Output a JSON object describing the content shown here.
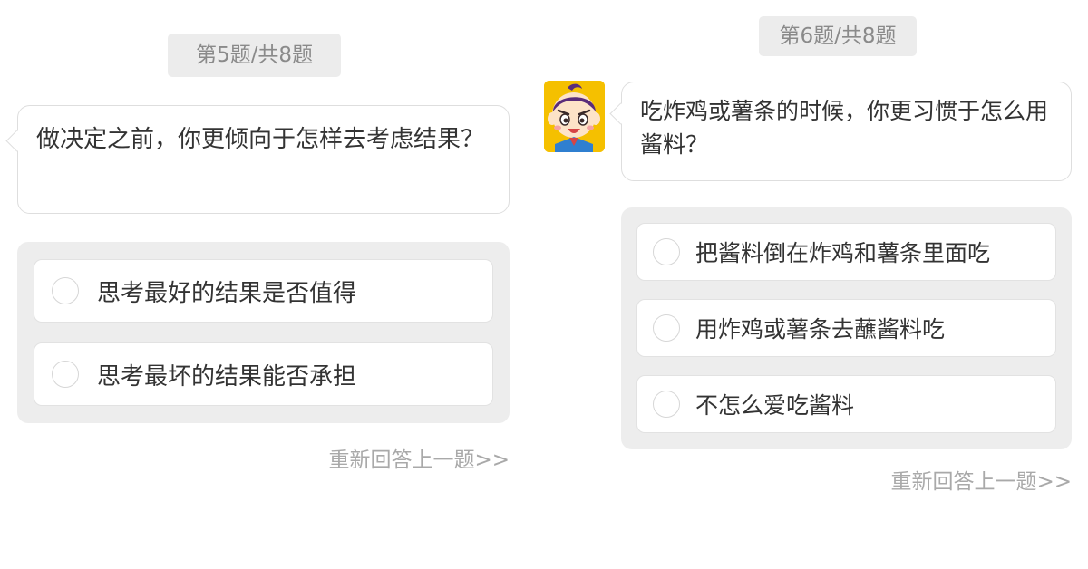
{
  "left_panel": {
    "counter": "第5题/共8题",
    "question": "做决定之前，你更倾向于怎样去考虑结果？",
    "options": [
      {
        "label": "思考最好的结果是否值得"
      },
      {
        "label": "思考最坏的结果能否承担"
      }
    ],
    "redo_link": "重新回答上一题>>"
  },
  "right_panel": {
    "counter": "第6题/共8题",
    "question": "吃炸鸡或薯条的时候，你更习惯于怎么用酱料？",
    "options": [
      {
        "label": "把酱料倒在炸鸡和薯条里面吃"
      },
      {
        "label": "用炸鸡或薯条去蘸酱料吃"
      },
      {
        "label": "不怎么爱吃酱料"
      }
    ],
    "redo_link": "重新回答上一题>>"
  },
  "colors": {
    "pill_bg": "#ececec",
    "options_bg": "#ededed",
    "muted_text": "#a9a9a9",
    "avatar_bg": "#f5c000"
  },
  "icons": {
    "avatar": "cartoon-boy-avatar-icon",
    "radio": "radio-unchecked-icon"
  }
}
